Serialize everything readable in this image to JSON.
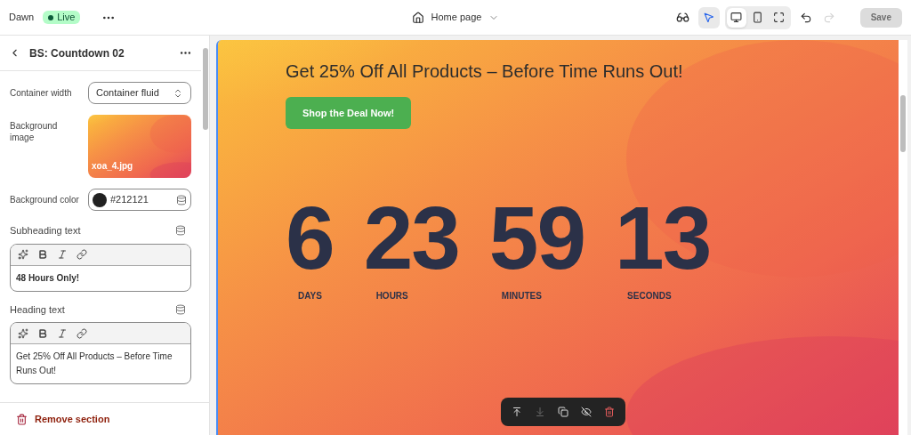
{
  "topbar": {
    "theme": "Dawn",
    "status": {
      "label": "Live",
      "color": "#0d5c3a"
    },
    "page": "Home page",
    "inspector_on": true,
    "views": [
      {
        "kind": "desktop",
        "selected": true
      },
      {
        "kind": "mobile",
        "selected": false
      },
      {
        "kind": "fullscreen",
        "selected": false
      }
    ],
    "undo_disabled": false,
    "redo_disabled": true,
    "save": {
      "label": "Save",
      "disabled": true
    }
  },
  "sidebar": {
    "title": "BS: Countdown 02",
    "fields": [
      {
        "kind": "select",
        "label": "Container width",
        "value": "Container fluid"
      },
      {
        "label": "Background image",
        "value": "xoa_4.jpg"
      },
      {
        "kind": "color",
        "label": "Background color",
        "value": "#212121",
        "color": "#212121"
      },
      {
        "kind": "richtext",
        "label": "Subheading text",
        "value": "48 Hours Only!",
        "bold": true
      },
      {
        "kind": "richtext",
        "label": "Heading text",
        "value": "Get 25% Off All Products – Before Time Runs Out!",
        "bold": false
      }
    ],
    "remove": "Remove section"
  },
  "preview": {
    "heading": "Get 25% Off All Products – Before Time Runs Out!",
    "button": "Shop the Deal Now!",
    "countdown": [
      {
        "value": "6",
        "unit": "DAYS"
      },
      {
        "value": "23",
        "unit": "HOURS"
      },
      {
        "value": "59",
        "unit": "MINUTES"
      },
      {
        "value": "13",
        "unit": "SECONDS"
      }
    ],
    "toolbar": [
      {
        "kind": "move-up",
        "disabled": false
      },
      {
        "kind": "move-down",
        "disabled": true
      },
      {
        "kind": "duplicate",
        "disabled": false
      },
      {
        "kind": "hide",
        "disabled": false
      },
      {
        "kind": "delete",
        "disabled": false
      }
    ]
  }
}
